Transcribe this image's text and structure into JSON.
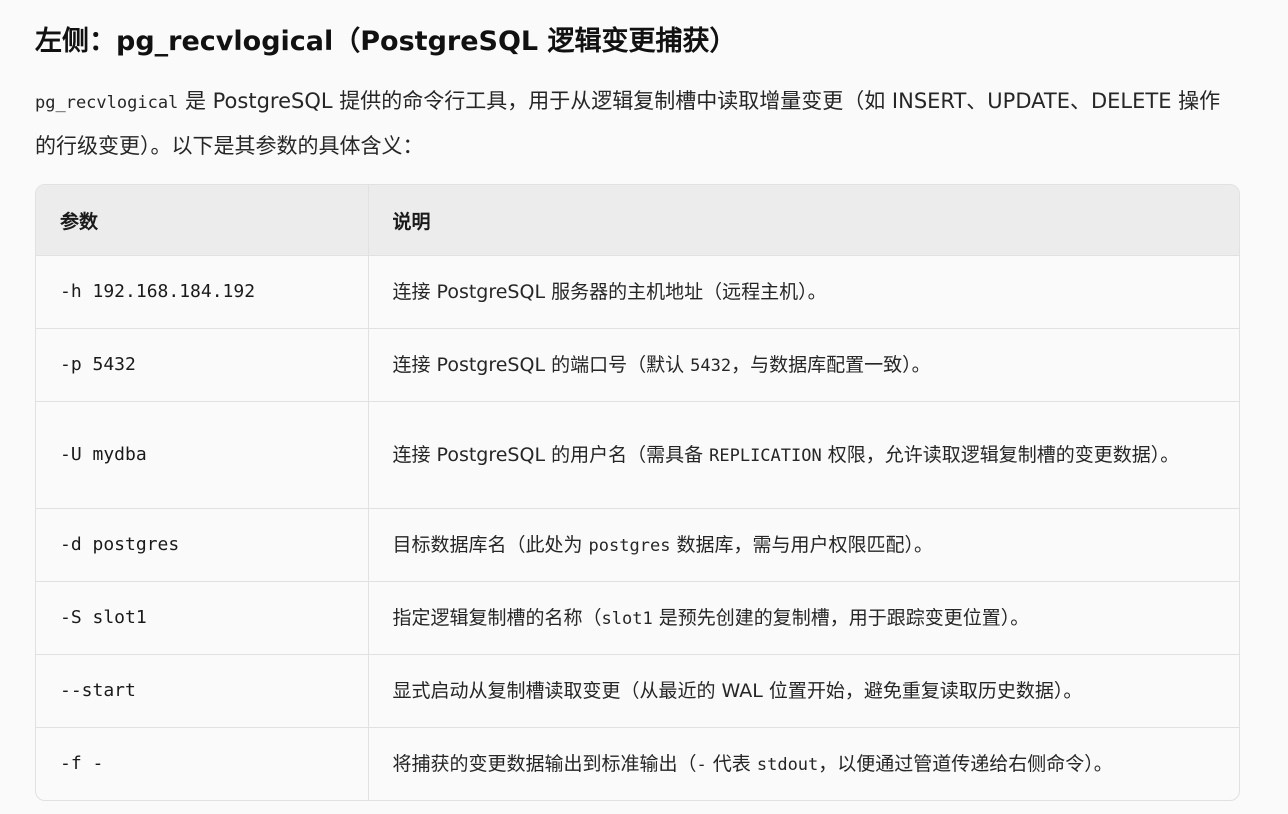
{
  "heading": "左侧：pg_recvlogical（PostgreSQL 逻辑变更捕获）",
  "intro": {
    "code": "pg_recvlogical",
    "text": " 是 PostgreSQL 提供的命令行工具，用于从逻辑复制槽中读取增量变更（如 INSERT、UPDATE、DELETE 操作的行级变更）。以下是其参数的具体含义："
  },
  "table": {
    "headers": [
      "参数",
      "说明"
    ],
    "rows": [
      {
        "param": "-h 192.168.184.192",
        "desc": [
          "连接 PostgreSQL 服务器的主机地址（远程主机）。"
        ]
      },
      {
        "param": "-p 5432",
        "desc": [
          "连接 PostgreSQL 的端口号（默认 ",
          "5432",
          "，与数据库配置一致）。"
        ]
      },
      {
        "param": "-U mydba",
        "desc": [
          "连接 PostgreSQL 的用户名（需具备 ",
          "REPLICATION",
          " 权限，允许读取逻辑复制槽的变更数据）。"
        ]
      },
      {
        "param": "-d postgres",
        "desc": [
          "目标数据库名（此处为 ",
          "postgres",
          " 数据库，需与用户权限匹配）。"
        ]
      },
      {
        "param": "-S slot1",
        "desc": [
          "指定逻辑复制槽的名称（",
          "slot1",
          " 是预先创建的复制槽，用于跟踪变更位置）。"
        ]
      },
      {
        "param": "--start",
        "desc": [
          "显式启动从复制槽读取变更（从最近的 WAL 位置开始，避免重复读取历史数据）。"
        ]
      },
      {
        "param": "-f -",
        "desc": [
          "将捕获的变更数据输出到标准输出（",
          "-",
          " 代表 ",
          "stdout",
          "，以便通过管道传递给右侧命令）。"
        ]
      }
    ]
  }
}
